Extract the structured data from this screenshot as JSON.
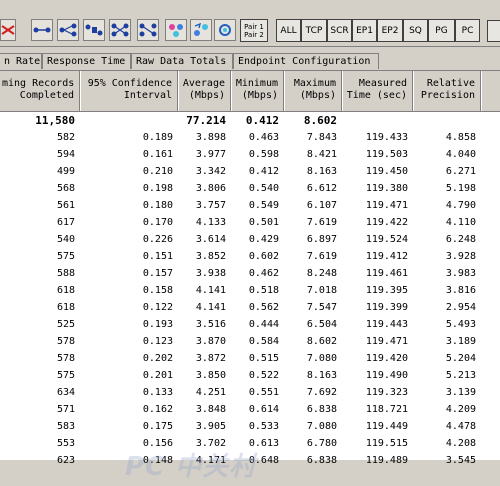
{
  "toolbar": {
    "filters": [
      "ALL",
      "TCP",
      "SCR",
      "EP1",
      "EP2",
      "SQ",
      "PG",
      "PC"
    ],
    "pair_label_1": "Pair 1",
    "pair_label_2": "Pair 2"
  },
  "tabs": [
    "n Rate",
    "Response Time",
    "Raw Data Totals",
    "Endpoint Configuration"
  ],
  "columns": [
    "ming Records\n Completed",
    "95% Confidence\nInterval",
    "Average\n(Mbps)",
    "Minimum\n(Mbps)",
    "Maximum\n(Mbps)",
    "Measured\nTime (sec)",
    "Relative\nPrecision"
  ],
  "totals": [
    "11,580",
    "",
    "77.214",
    "0.412",
    "8.602",
    "",
    ""
  ],
  "rows": [
    [
      "582",
      "0.189",
      "3.898",
      "0.463",
      "7.843",
      "119.433",
      "4.858"
    ],
    [
      "594",
      "0.161",
      "3.977",
      "0.598",
      "8.421",
      "119.503",
      "4.040"
    ],
    [
      "499",
      "0.210",
      "3.342",
      "0.412",
      "8.163",
      "119.450",
      "6.271"
    ],
    [
      "568",
      "0.198",
      "3.806",
      "0.540",
      "6.612",
      "119.380",
      "5.198"
    ],
    [
      "561",
      "0.180",
      "3.757",
      "0.549",
      "6.107",
      "119.471",
      "4.790"
    ],
    [
      "617",
      "0.170",
      "4.133",
      "0.501",
      "7.619",
      "119.422",
      "4.110"
    ],
    [
      "540",
      "0.226",
      "3.614",
      "0.429",
      "6.897",
      "119.524",
      "6.248"
    ],
    [
      "575",
      "0.151",
      "3.852",
      "0.602",
      "7.619",
      "119.412",
      "3.928"
    ],
    [
      "588",
      "0.157",
      "3.938",
      "0.462",
      "8.248",
      "119.461",
      "3.983"
    ],
    [
      "618",
      "0.158",
      "4.141",
      "0.518",
      "7.018",
      "119.395",
      "3.816"
    ],
    [
      "618",
      "0.122",
      "4.141",
      "0.562",
      "7.547",
      "119.399",
      "2.954"
    ],
    [
      "525",
      "0.193",
      "3.516",
      "0.444",
      "6.504",
      "119.443",
      "5.493"
    ],
    [
      "578",
      "0.123",
      "3.870",
      "0.584",
      "8.602",
      "119.471",
      "3.189"
    ],
    [
      "578",
      "0.202",
      "3.872",
      "0.515",
      "7.080",
      "119.420",
      "5.204"
    ],
    [
      "575",
      "0.201",
      "3.850",
      "0.522",
      "8.163",
      "119.490",
      "5.213"
    ],
    [
      "634",
      "0.133",
      "4.251",
      "0.551",
      "7.692",
      "119.323",
      "3.139"
    ],
    [
      "571",
      "0.162",
      "3.848",
      "0.614",
      "6.838",
      "118.721",
      "4.209"
    ],
    [
      "583",
      "0.175",
      "3.905",
      "0.533",
      "7.080",
      "119.449",
      "4.478"
    ],
    [
      "553",
      "0.156",
      "3.702",
      "0.613",
      "6.780",
      "119.515",
      "4.208"
    ],
    [
      "623",
      "0.148",
      "4.171",
      "0.648",
      "6.838",
      "119.489",
      "3.545"
    ]
  ],
  "icons": [
    "disconnect-icon",
    "pair-icon",
    "pair-fanout-icon",
    "pair-filter-icon",
    "cross-pair-icon",
    "cross-pair-alt-icon",
    "endpoint-color-icon",
    "refresh-icon",
    "sync-icon"
  ],
  "watermark": "PC 中关村"
}
